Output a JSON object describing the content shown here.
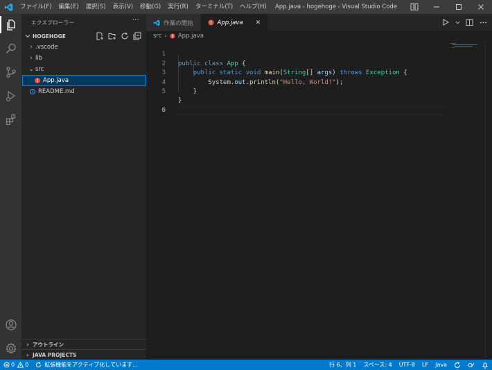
{
  "titlebar": {
    "menus": [
      "ファイル(F)",
      "編集(E)",
      "選択(S)",
      "表示(V)",
      "移動(G)",
      "実行(R)",
      "ターミナル(T)",
      "ヘルプ(H)"
    ],
    "window_title": "App.java - hogehoge - Visual Studio Code"
  },
  "sidebar": {
    "header": "エクスプローラー",
    "more": "···",
    "workspace": "HOGEHOGE",
    "tree": [
      {
        "label": ".vscode",
        "chevron": "›"
      },
      {
        "label": "lib",
        "chevron": "›"
      },
      {
        "label": "src",
        "chevron": "⌄"
      },
      {
        "label": "App.java",
        "badge": "!"
      },
      {
        "label": "README.md",
        "badge": "i"
      }
    ],
    "bottom_sections": [
      {
        "label": "アウトライン",
        "chevron": "›"
      },
      {
        "label": "JAVA PROJECTS",
        "chevron": "›"
      }
    ]
  },
  "tabs": [
    {
      "label": "作業の開始"
    },
    {
      "label": "App.java",
      "close": "✕"
    }
  ],
  "breadcrumbs": [
    "src",
    "App.java"
  ],
  "breadcrumb_sep": "›",
  "editor": {
    "line_numbers": [
      "1",
      "2",
      "3",
      "4",
      "5",
      "6"
    ],
    "lines": {
      "l1": {
        "a": "public",
        "b": " ",
        "c": "class",
        "d": " ",
        "e": "App",
        "f": " {"
      },
      "l2": {
        "a": "    ",
        "b": "public",
        "c": " ",
        "d": "static",
        "e": " ",
        "f": "void",
        "g": " ",
        "h": "main",
        "i": "(",
        "j": "String",
        "k": "[] ",
        "l": "args",
        "m": ") ",
        "n": "throws",
        "o": " ",
        "p": "Exception",
        "q": " {"
      },
      "l3": {
        "a": "        System.",
        "b": "out",
        "c": ".",
        "d": "println",
        "e": "(",
        "f": "\"Hello, World!\"",
        "g": ");"
      },
      "l4": {
        "a": "    }"
      },
      "l5": {
        "a": "}"
      }
    }
  },
  "statusbar": {
    "errors": "0",
    "warnings": "0",
    "activating": "拡張機能をアクティブ化しています...",
    "position": "行 6、列 1",
    "spaces": "スペース: 4",
    "encoding": "UTF-8",
    "eol": "LF",
    "language": "Java"
  },
  "colors": {
    "accent": "#007acc",
    "error": "#e8503a",
    "info": "#3794ff",
    "selection": "#04395e"
  }
}
